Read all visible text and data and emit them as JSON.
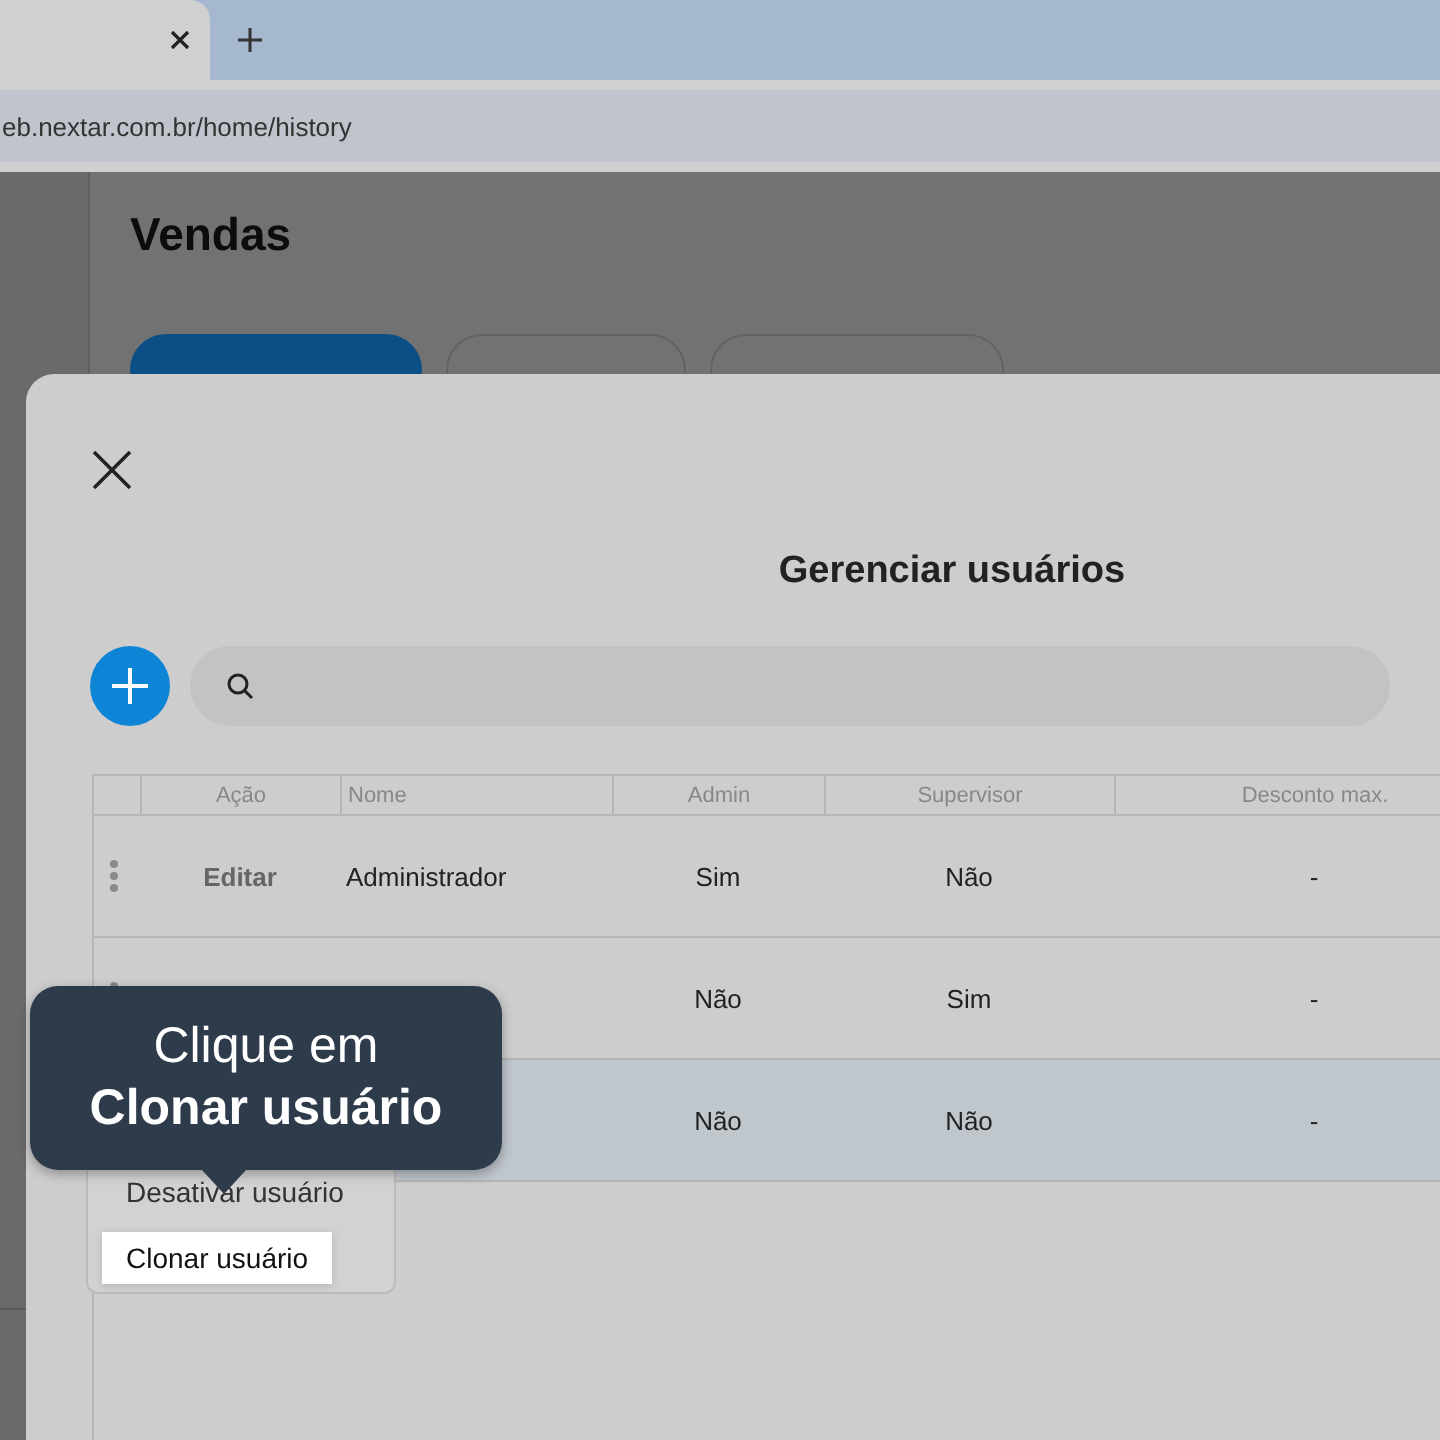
{
  "browser": {
    "tabs": [
      {
        "selected": true
      }
    ],
    "url": "eb.nextar.com.br/home/history"
  },
  "page": {
    "title": "Vendas",
    "buttons": [
      {
        "kind": "primary"
      },
      {
        "kind": "outline"
      },
      {
        "kind": "outline"
      }
    ]
  },
  "dialog": {
    "title": "Gerenciar usuários",
    "table": {
      "columns": [
        "Ação",
        "Nome",
        "Admin",
        "Supervisor",
        "Desconto max."
      ],
      "rows": [
        {
          "action": "Editar",
          "name": "Administrador",
          "admin": "Sim",
          "supervisor": "Não",
          "discount": "-",
          "selected": false
        },
        {
          "admin": "Não",
          "supervisor": "Sim",
          "discount": "-",
          "selected": false
        },
        {
          "admin": "Não",
          "supervisor": "Não",
          "discount": "-",
          "selected": true
        }
      ]
    },
    "context_menu": {
      "items": [
        {
          "label": "Desativar usuário",
          "selected": false
        },
        {
          "label": "Clonar usuário",
          "selected": true
        }
      ]
    }
  },
  "tooltip": {
    "text": "Clique em\n**Clonar usuário**"
  }
}
